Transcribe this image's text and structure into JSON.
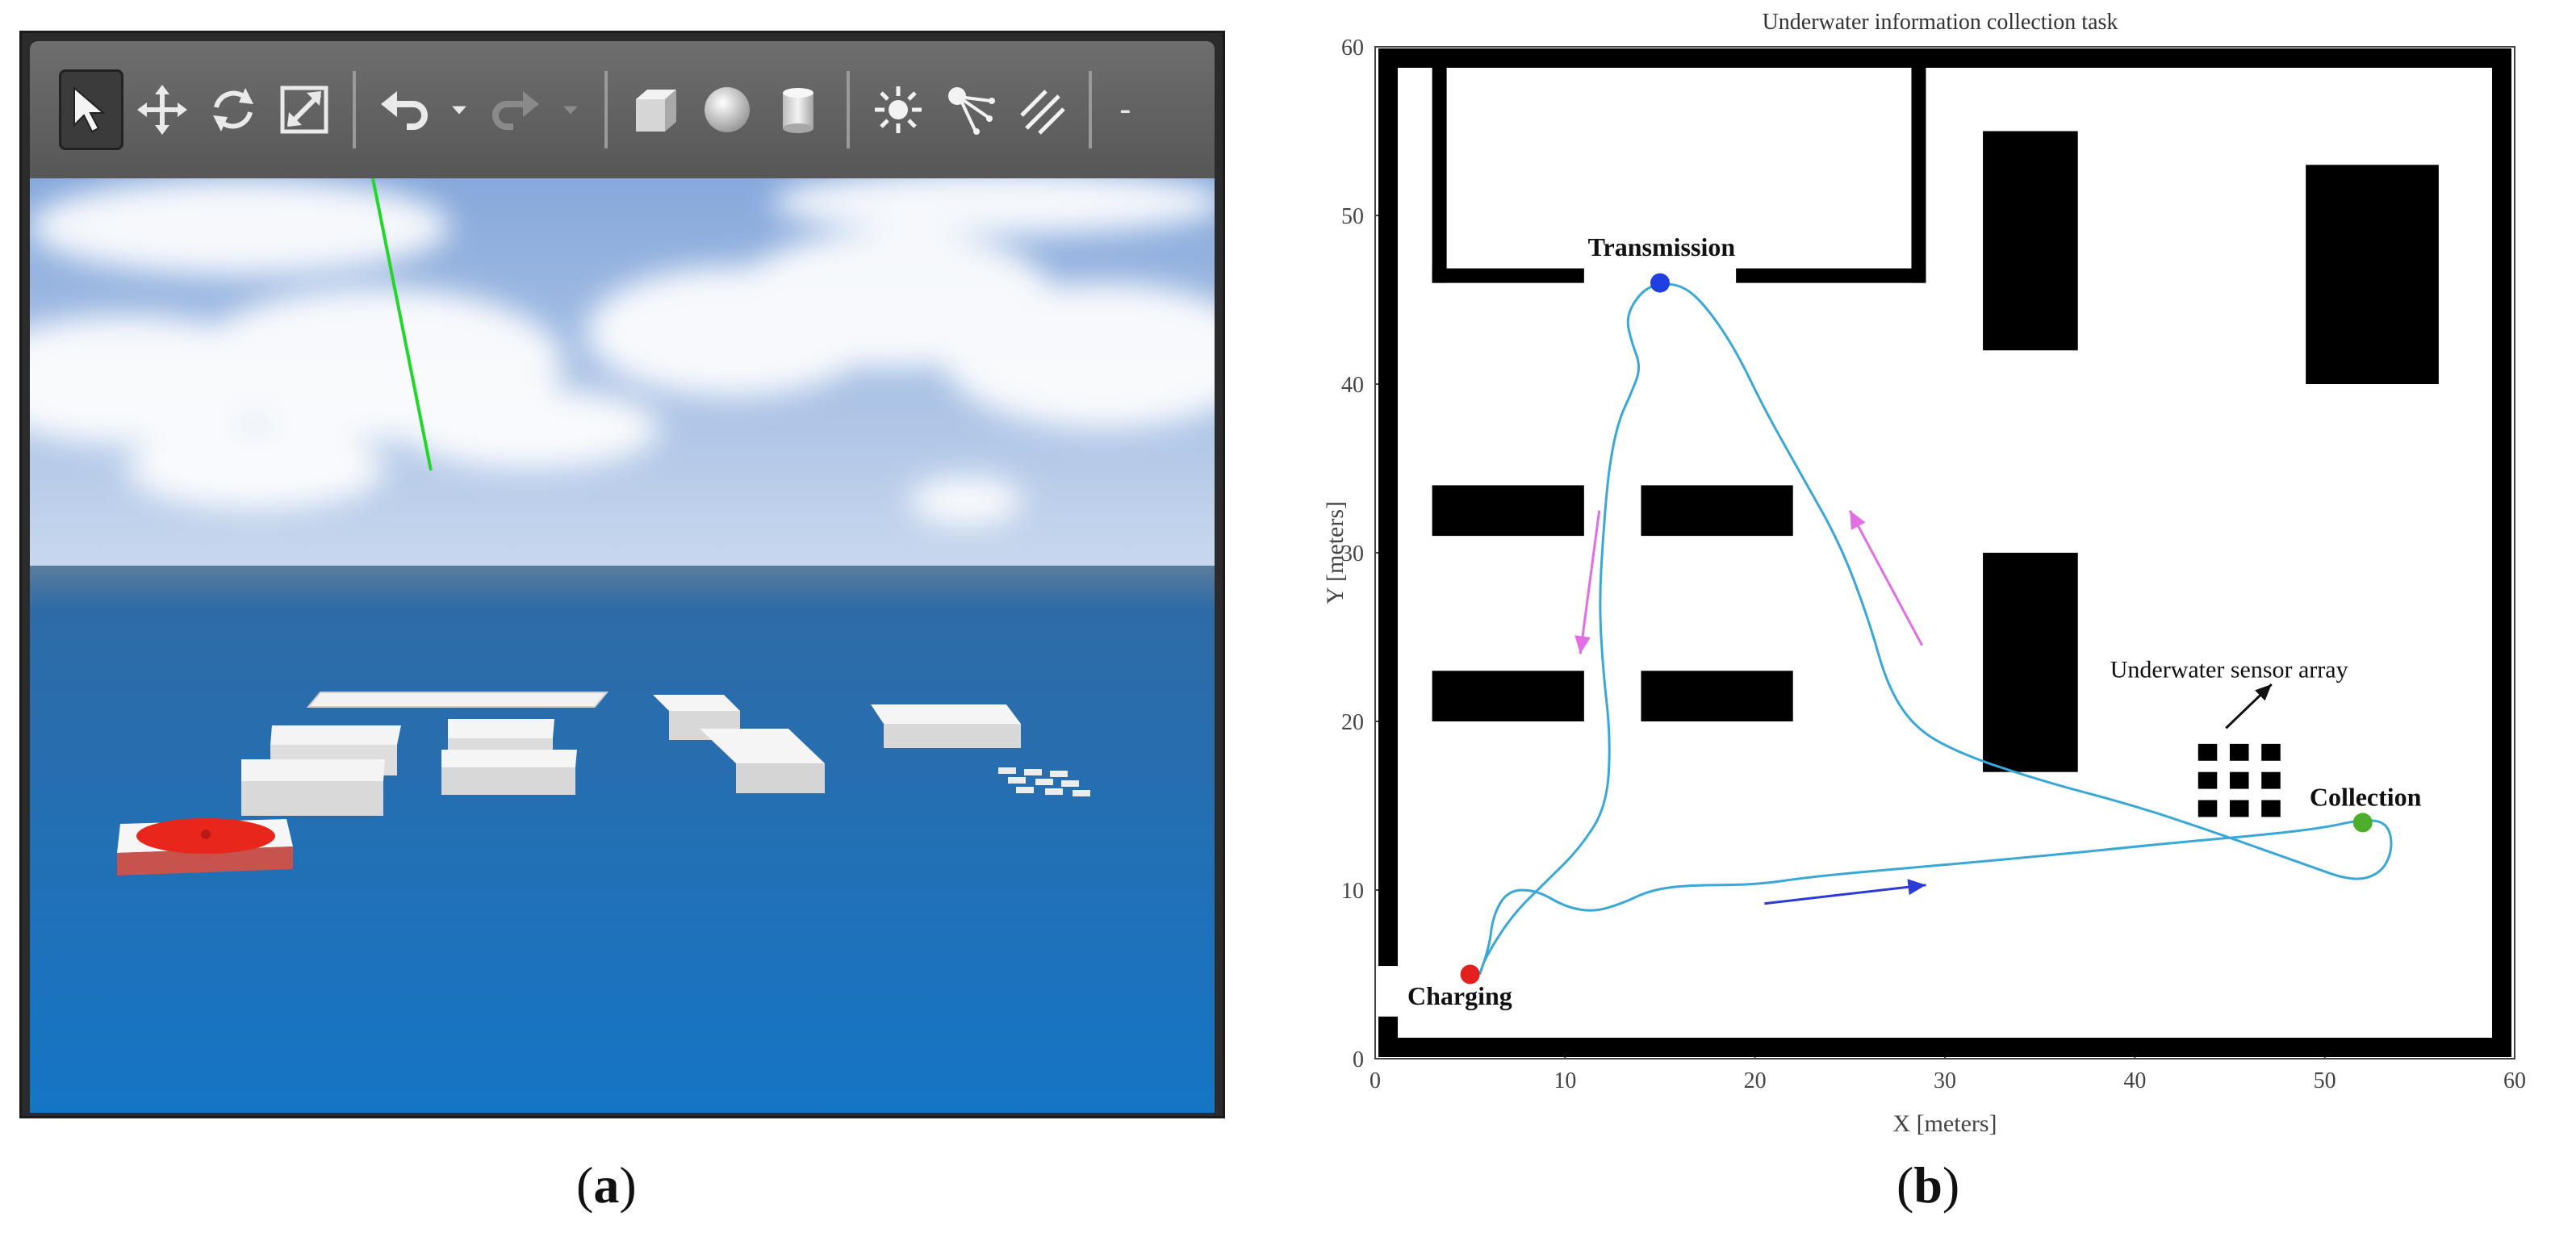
{
  "panel_a": {
    "caption_open": "(",
    "caption_letter": "a",
    "caption_close": ")",
    "toolbar": {
      "tools": [
        {
          "icon": "select-arrow-icon",
          "active": true
        },
        {
          "icon": "translate-icon",
          "active": false
        },
        {
          "icon": "rotate-icon",
          "active": false
        },
        {
          "icon": "scale-icon",
          "active": false
        }
      ],
      "history": [
        "undo-icon",
        "redo-icon"
      ],
      "shapes": [
        "box-icon",
        "sphere-icon",
        "cylinder-icon"
      ],
      "lights": [
        "point-light-icon",
        "spot-light-icon",
        "directional-light-icon"
      ],
      "overflow_label": "-"
    },
    "colors": {
      "sky_top": "#8fb1dd",
      "sea": "#1a6bb0",
      "block": "#e9e9e9",
      "charging_pad": "#e8261c",
      "ray": "#22d62a"
    }
  },
  "panel_b": {
    "caption_open": "(",
    "caption_letter": "b",
    "caption_close": ")",
    "annotations": {
      "transmission": "Transmission",
      "charging": "Charging",
      "collection": "Collection",
      "sensor_array": "Underwater sensor array"
    },
    "colors": {
      "path": "#3aa7d6",
      "transmission": "#1f3fe0",
      "charging": "#e32020",
      "collection": "#4cae2a",
      "arrow_down": "#e36de3",
      "arrow_up": "#e36de3",
      "arrow_right": "#2a3bd8"
    }
  },
  "chart_data": {
    "type": "line",
    "title": "Underwater information collection task",
    "xlabel": "X [meters]",
    "ylabel": "Y [meters]",
    "xlim": [
      0,
      60
    ],
    "ylim": [
      0,
      60
    ],
    "xticks": [
      "0",
      "10",
      "20",
      "30",
      "40",
      "50",
      "60"
    ],
    "yticks": [
      "0",
      "10",
      "20",
      "30",
      "40",
      "50",
      "60"
    ],
    "grid": false,
    "series": [
      {
        "values": [
          [
            5.5,
            5
          ],
          [
            6,
            6.5
          ],
          [
            6.2,
            8.5
          ],
          [
            7,
            10
          ],
          [
            8.5,
            10
          ],
          [
            10,
            9
          ],
          [
            11.5,
            8.7
          ],
          [
            13,
            9.2
          ],
          [
            14.5,
            10
          ],
          [
            16.5,
            10.3
          ],
          [
            20,
            10.3
          ],
          [
            23,
            10.8
          ],
          [
            28,
            11.3
          ],
          [
            35,
            12
          ],
          [
            42,
            12.8
          ],
          [
            47,
            13.3
          ],
          [
            50,
            13.7
          ],
          [
            52,
            14.2
          ],
          [
            53.3,
            14
          ],
          [
            53.6,
            12.5
          ],
          [
            53,
            11
          ],
          [
            51.5,
            10.5
          ],
          [
            49,
            11.5
          ],
          [
            46.5,
            12.5
          ],
          [
            44,
            13.5
          ],
          [
            40,
            15
          ],
          [
            35,
            16.5
          ],
          [
            31,
            18
          ],
          [
            28.5,
            19.5
          ],
          [
            27,
            22
          ],
          [
            26,
            26
          ],
          [
            24.5,
            30.5
          ],
          [
            22.5,
            34.5
          ],
          [
            20.5,
            38.5
          ],
          [
            19,
            42
          ],
          [
            17.5,
            44.5
          ],
          [
            16.3,
            45.8
          ],
          [
            15,
            46
          ],
          [
            14,
            45.5
          ],
          [
            13.2,
            44
          ],
          [
            13.5,
            42.5
          ],
          [
            14,
            41
          ],
          [
            13.5,
            39.5
          ],
          [
            12.8,
            37.8
          ],
          [
            12.3,
            35
          ],
          [
            12,
            31
          ],
          [
            11.8,
            27
          ],
          [
            12,
            23
          ],
          [
            12.4,
            19
          ],
          [
            12.2,
            15
          ],
          [
            10.8,
            12.5
          ],
          [
            9,
            10.5
          ],
          [
            7.2,
            8.5
          ],
          [
            5.8,
            6
          ],
          [
            5.5,
            5
          ]
        ]
      }
    ],
    "markers": [
      {
        "label": "Transmission",
        "x": 15,
        "y": 46
      },
      {
        "label": "Charging",
        "x": 5,
        "y": 5
      },
      {
        "label": "Collection",
        "x": 52,
        "y": 14
      }
    ],
    "walls": [
      {
        "x": [
          3,
          29
        ],
        "y": [
          46,
          59
        ]
      },
      {
        "x": [
          0,
          60
        ],
        "y": [
          0,
          60
        ]
      }
    ],
    "obstacles": [
      {
        "x": [
          3,
          11
        ],
        "y": [
          31,
          34
        ]
      },
      {
        "x": [
          14,
          22
        ],
        "y": [
          31,
          34
        ]
      },
      {
        "x": [
          3,
          11
        ],
        "y": [
          20,
          23
        ]
      },
      {
        "x": [
          14,
          22
        ],
        "y": [
          20,
          23
        ]
      },
      {
        "x": [
          32,
          37
        ],
        "y": [
          42,
          55
        ]
      },
      {
        "x": [
          32,
          37
        ],
        "y": [
          17,
          30
        ]
      },
      {
        "x": [
          49,
          56
        ],
        "y": [
          40,
          53
        ]
      }
    ],
    "sensor_array": {
      "rows": 3,
      "cols": 3,
      "x": [
        43,
        48
      ],
      "y": [
        14,
        19
      ]
    }
  }
}
